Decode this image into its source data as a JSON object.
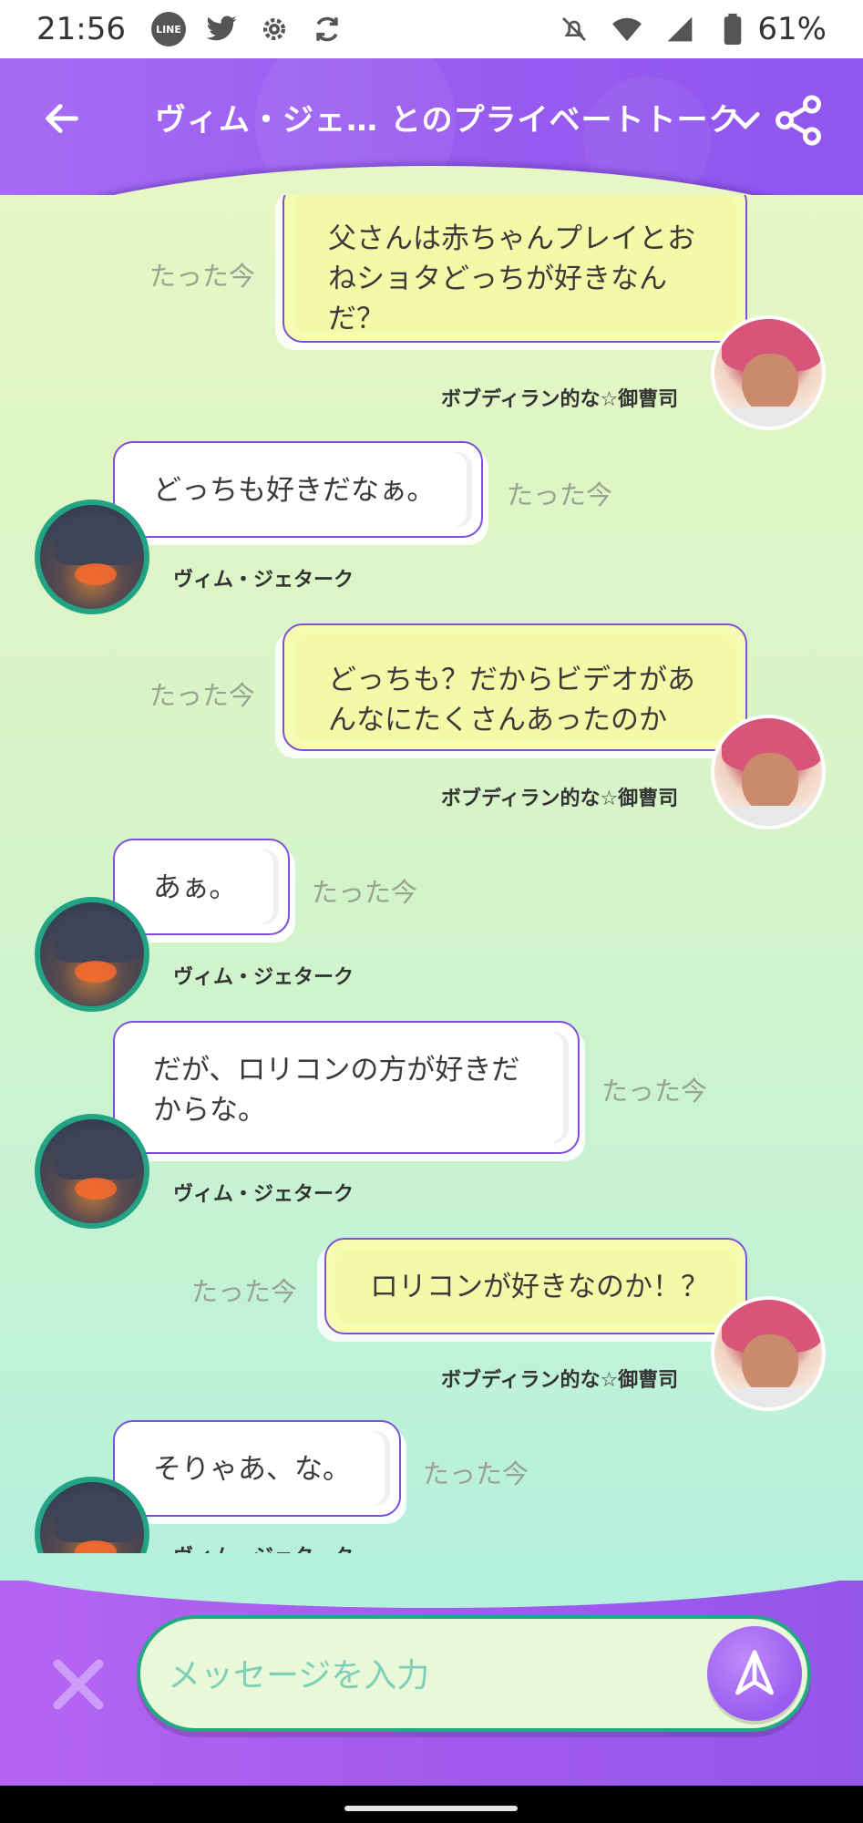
{
  "status_bar": {
    "time": "21:56",
    "battery": "61%",
    "left_icons": [
      "line-icon",
      "twitter-icon",
      "settings-icon",
      "sync-icon"
    ],
    "right_icons": [
      "mute-icon",
      "wifi-icon",
      "signal-icon",
      "battery-icon"
    ]
  },
  "header": {
    "title": "ヴィム・ジェ… とのプライベートトーク",
    "accent": "#9a5cf0"
  },
  "messages": [
    {
      "sender": "me",
      "text": "父さんは赤ちゃんプレイとお\nねショタどっちが好きなん\nだ？",
      "time": "たった今",
      "name": "ボブディラン的な☆御曹司"
    },
    {
      "sender": "other",
      "text": "どっちも好きだなぁ。",
      "time": "たった今",
      "name": "ヴィム・ジェターク"
    },
    {
      "sender": "me",
      "text": "どっちも？だからビデオがあ\nんなにたくさんあったのか",
      "time": "たった今",
      "name": "ボブディラン的な☆御曹司"
    },
    {
      "sender": "other",
      "text": "あぁ。",
      "time": "たった今",
      "name": "ヴィム・ジェターク"
    },
    {
      "sender": "other",
      "text": "だが、ロリコンの方が好きだ\nからな。",
      "time": "たった今",
      "name": "ヴィム・ジェターク"
    },
    {
      "sender": "me",
      "text": "ロリコンが好きなのか！？",
      "time": "たった今",
      "name": "ボブディラン的な☆御曹司"
    },
    {
      "sender": "other",
      "text": "そりゃあ、な。",
      "time": "たった今",
      "name": "ヴィム・ジェターク"
    }
  ],
  "composer": {
    "placeholder": "メッセージを入力",
    "value": ""
  }
}
